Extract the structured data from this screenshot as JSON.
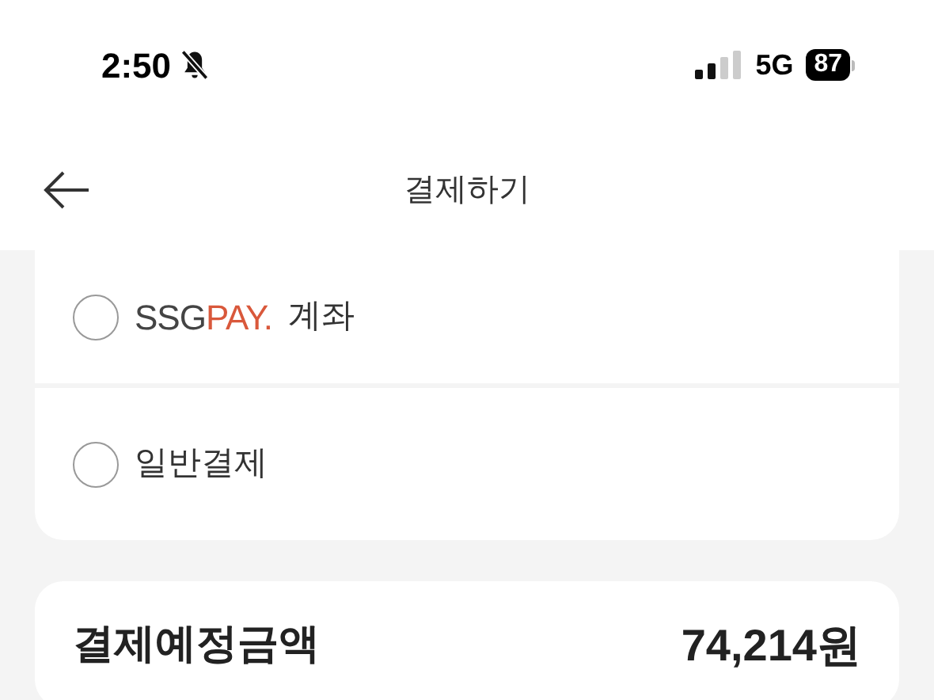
{
  "status_bar": {
    "time": "2:50",
    "network": "5G",
    "battery": "87"
  },
  "header": {
    "title": "결제하기"
  },
  "payment_options": [
    {
      "kind": "brand",
      "brand_dark": "SSG",
      "brand_accent": "PAY.",
      "label": "계좌",
      "selected": false
    },
    {
      "kind": "plain",
      "label": "일반결제",
      "selected": false
    }
  ],
  "summary": {
    "label": "결제예정금액",
    "amount": "74,214원"
  }
}
